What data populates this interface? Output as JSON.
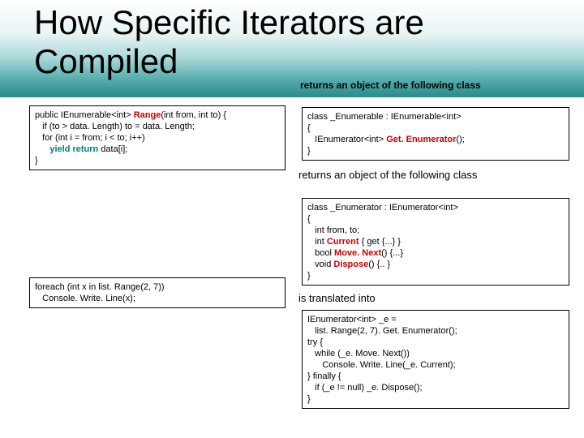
{
  "title": "How Specific Iterators are\nCompiled",
  "subtitle_right": "returns an object of the following class",
  "returns_text": "returns an object of the following class",
  "translated_text": "is translated into",
  "code": {
    "range": {
      "ret_type": "IEnumerable<int>",
      "name": "Range",
      "sig": "(int from, int to) {",
      "l1": "   if (to > data. Length) to = data. Length;",
      "l2": "   for (int i = from; i < to; i++)",
      "yield": "yield return",
      "l3": " data[i];",
      "l4": "}"
    },
    "enumclass": {
      "l0": "class _Enumerable : IEnumerable<int>",
      "l1": "{",
      "ret": "IEnumerator<int>",
      "method": "Get. Enumerator",
      "l3": "}"
    },
    "enumtor": {
      "l0": "class _Enumerator : IEnumerator<int>",
      "l1": "{",
      "l2": "   int from, to;",
      "cur": "Current",
      "l3b": " { get {...} }",
      "mv": "Move. Next",
      "l4b": "() {...}",
      "dis": "Dispose",
      "l5b": "() {.. }",
      "l6": "}"
    },
    "foreach": {
      "l0": "foreach (int x in list. Range(2, 7))",
      "l1": "   Console. Write. Line(x);"
    },
    "trans": {
      "l0a": "IEnumerator<int>",
      "l0b": " _e =",
      "l1": "   list. Range(2, 7). Get. Enumerator();",
      "l2": "try {",
      "l3": "   while (_e. Move. Next())",
      "l4": "      Console. Write. Line(_e. Current);",
      "l5": "} finally {",
      "l6": "   if (_e != null) _e. Dispose();",
      "l7": "}"
    }
  }
}
